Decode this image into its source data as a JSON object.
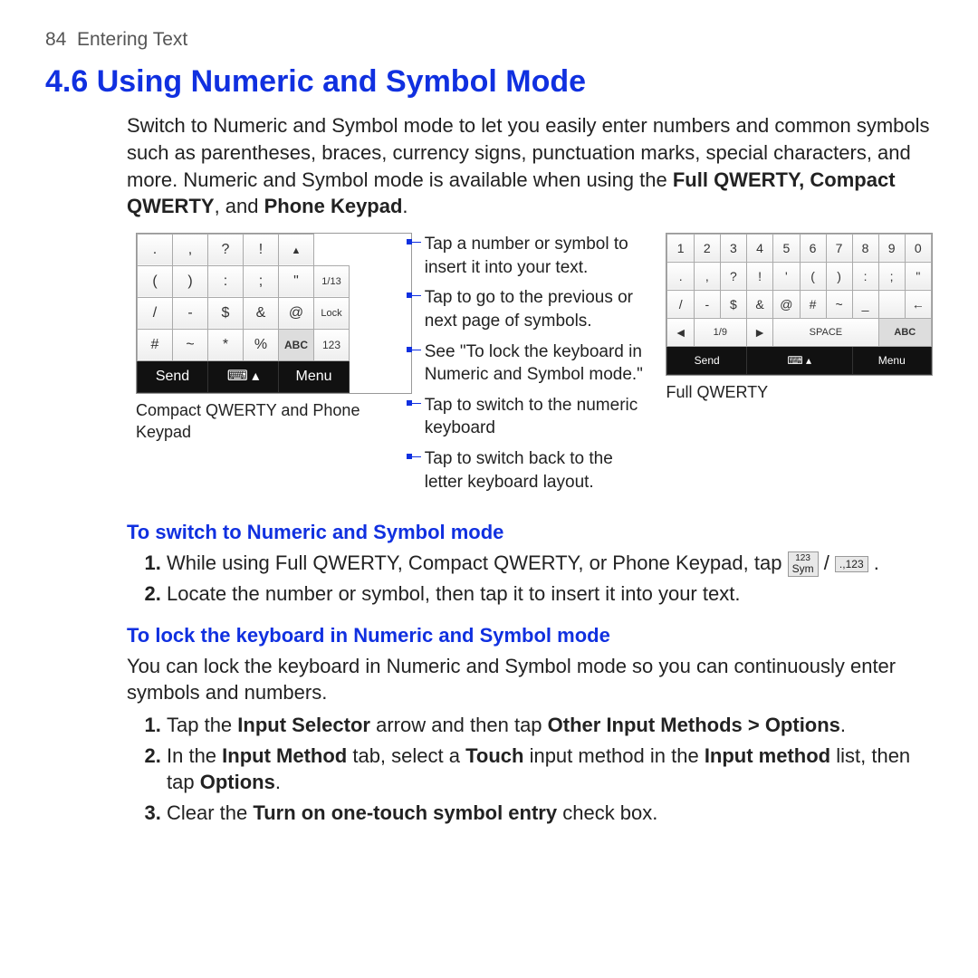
{
  "runhead": {
    "page_no": "84",
    "title": "Entering Text"
  },
  "heading": "4.6 Using Numeric and Symbol Mode",
  "intro": {
    "pre": "Switch to Numeric and Symbol mode to let you easily enter numbers and common symbols such as parentheses, braces, currency signs, punctuation marks, special characters, and more. Numeric and Symbol mode is available when using the ",
    "b1": "Full QWERTY, Compact QWERTY",
    "mid": ", and ",
    "b2": "Phone Keypad",
    "post": "."
  },
  "annotations": {
    "a1": "Tap a number or symbol to insert it into your text.",
    "a2": "Tap to go to the previous or next page of symbols.",
    "a3": "See \"To lock the keyboard in Numeric and Symbol mode.\"",
    "a4": "Tap to switch to the numeric keyboard",
    "a5": "Tap to switch back to the letter keyboard layout."
  },
  "kb_left": {
    "rows": [
      [
        ".",
        ",",
        "?",
        "!",
        "▲"
      ],
      [
        "(",
        ")",
        ":",
        ";",
        "\""
      ],
      [
        "/",
        "-",
        "$",
        "&",
        "@"
      ],
      [
        "#",
        "~",
        "*",
        "%",
        "ABC"
      ]
    ],
    "page_ind": "1/13",
    "lock": "Lock",
    "num123": "123",
    "send": "Send",
    "menu": "Menu",
    "caption": "Compact QWERTY and Phone Keypad"
  },
  "kb_right": {
    "rows": [
      [
        "1",
        "2",
        "3",
        "4",
        "5",
        "6",
        "7",
        "8",
        "9",
        "0"
      ],
      [
        ".",
        ",",
        "?",
        "!",
        "'",
        "(",
        ")",
        ":",
        ";",
        "\""
      ],
      [
        "/",
        "-",
        "$",
        "&",
        "@",
        "#",
        "~",
        "_",
        "",
        "←"
      ]
    ],
    "page_nav": {
      "prev": "◄",
      "ind": "1/9",
      "next": "►"
    },
    "space": "SPACE",
    "abc": "ABC",
    "send": "Send",
    "menu": "Menu",
    "caption": "Full QWERTY"
  },
  "switch_h": "To switch to Numeric and Symbol mode",
  "switch_steps": {
    "s1_pre": "While using Full QWERTY, Compact QWERTY, or Phone Keypad, tap ",
    "s1_key1_top": "123",
    "s1_key1_bot": "Sym",
    "s1_sep": " / ",
    "s1_key2": ".,123",
    "s1_post": " .",
    "s2": "Locate the number or symbol, then tap it to insert it into your text."
  },
  "lock_h": "To lock the keyboard in Numeric and Symbol mode",
  "lock_para": "You can lock the keyboard in Numeric and Symbol mode so you can continuously enter symbols and numbers.",
  "lock_steps": {
    "s1_pre": "Tap the ",
    "s1_b1": "Input Selector",
    "s1_mid": " arrow and then tap ",
    "s1_b2": "Other Input Methods > Options",
    "s1_post": ".",
    "s2_pre": "In the ",
    "s2_b1": "Input Method",
    "s2_mid1": " tab, select a ",
    "s2_b2": "Touch",
    "s2_mid2": " input method in the ",
    "s2_b3": "Input method",
    "s2_mid3": " list, then tap ",
    "s2_b4": "Options",
    "s2_post": ".",
    "s3_pre": "Clear the ",
    "s3_b1": "Turn on one-touch symbol entry",
    "s3_post": " check box."
  }
}
